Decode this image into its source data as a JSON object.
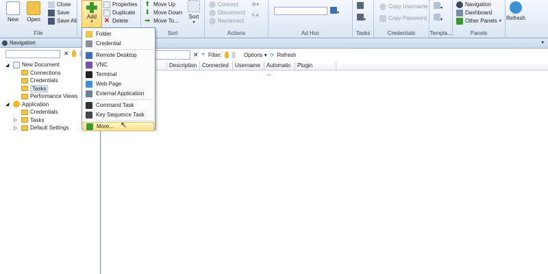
{
  "ribbon": {
    "file": {
      "label": "File",
      "new_label": "New",
      "open_label": "Open",
      "close_label": "Close",
      "save_label": "Save",
      "save_all_label": "Save All"
    },
    "add": {
      "add_label": "Add",
      "properties_label": "Properties",
      "duplicate_label": "Duplicate",
      "delete_label": "Delete"
    },
    "sort": {
      "label": "Sort",
      "move_up_label": "Move Up",
      "move_down_label": "Move Down",
      "move_to_label": "Move To...",
      "sort_label": "Sort"
    },
    "actions": {
      "label": "Actions",
      "connect_label": "Connect",
      "disconnect_label": "Disconnect",
      "reconnect_label": "Reconnect"
    },
    "adhoc": {
      "label": "Ad Hoc",
      "input_value": ""
    },
    "tasks": {
      "label": "Tasks"
    },
    "credentials": {
      "label": "Credentials",
      "copy_username_label": "Copy Username",
      "copy_password_label": "Copy Password"
    },
    "templates": {
      "label": "Templa..."
    },
    "panels": {
      "label": "Panels",
      "navigation_label": "Navigation",
      "dashboard_label": "Dashboard",
      "other_panels_label": "Other Panels"
    },
    "refresh_label": "Refresh"
  },
  "navigation": {
    "title": "Navigation",
    "search_value": "",
    "tree": [
      {
        "label": "New Document",
        "indent": 0,
        "expander": "minus",
        "type": "doc"
      },
      {
        "label": "Connections",
        "indent": 1,
        "type": "folder"
      },
      {
        "label": "Credentials",
        "indent": 1,
        "type": "folder"
      },
      {
        "label": "Tasks",
        "indent": 1,
        "type": "folder",
        "selected": true
      },
      {
        "label": "Performance Views",
        "indent": 1,
        "type": "folder"
      },
      {
        "label": "Application",
        "indent": 0,
        "expander": "minus",
        "type": "app"
      },
      {
        "label": "Credentials",
        "indent": 1,
        "type": "folder"
      },
      {
        "label": "Tasks",
        "indent": 1,
        "type": "folder",
        "expander": "plus"
      },
      {
        "label": "Default Settings",
        "indent": 1,
        "type": "folder",
        "expander": "plus"
      }
    ]
  },
  "main": {
    "filter_label": "Filter:",
    "options_label": "Options",
    "refresh_label": "Refresh",
    "columns": [
      "Description",
      "Connected",
      "Username",
      "Automatic ...",
      "Plugin"
    ]
  },
  "add_menu": {
    "items": [
      {
        "label": "Folder",
        "icon": "folder-icon",
        "color": "#f1c44a"
      },
      {
        "label": "Credential",
        "icon": "key-icon",
        "color": "#8a8f99"
      },
      {
        "separator": true
      },
      {
        "label": "Remote Desktop",
        "icon": "remote-desktop-icon",
        "color": "#3b6fb6"
      },
      {
        "label": "VNC",
        "icon": "vnc-icon",
        "color": "#7a4fb0"
      },
      {
        "label": "Terminal",
        "icon": "terminal-icon",
        "color": "#222222"
      },
      {
        "label": "Web Page",
        "icon": "web-page-icon",
        "color": "#3f8fd6"
      },
      {
        "label": "External Application",
        "icon": "external-app-icon",
        "color": "#6b7f99"
      },
      {
        "separator": true
      },
      {
        "label": "Command Task",
        "icon": "command-task-icon",
        "color": "#333333"
      },
      {
        "label": "Key Sequence Task",
        "icon": "key-sequence-icon",
        "color": "#444444"
      },
      {
        "separator": true
      },
      {
        "label": "More...",
        "icon": "plus-icon",
        "color": "#3a9a2e",
        "highlighted": true
      }
    ]
  },
  "colors": {
    "ribbon_bg": "#dbe6f4",
    "accent_green": "#3a9a2e",
    "highlight": "#ffe48a"
  }
}
